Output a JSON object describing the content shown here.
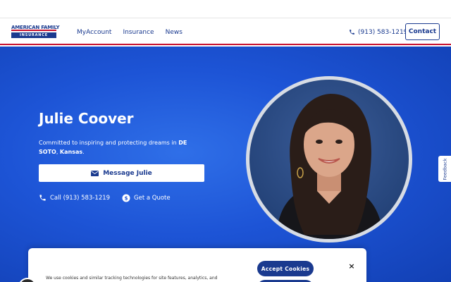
{
  "header": {
    "logo_line1": "AMERICAN FAMILY",
    "logo_line2": "INSURANCE",
    "nav": [
      "MyAccount",
      "Insurance",
      "News"
    ],
    "phone": "(913) 583-1219",
    "contact_label": "Contact"
  },
  "hero": {
    "name": "Julie Coover",
    "tagline_prefix": "Committed to inspiring and protecting dreams in ",
    "city": "DE SOTO",
    "tagline_sep": ", ",
    "state": "Kansas",
    "tagline_end": ".",
    "message_label": "Message Julie",
    "call_label": "Call (913) 583-1219",
    "quote_label": "Get a Quote"
  },
  "feedback_label": "Feedback",
  "cookie": {
    "text": "We use cookies and similar tracking technologies for site features, analytics, and",
    "accept_label": "Accept Cookies",
    "close_label": "×"
  },
  "colors": {
    "brand_blue": "#1a3a8f",
    "brand_red": "#c8102e",
    "hero_blue": "#1d54d6"
  }
}
